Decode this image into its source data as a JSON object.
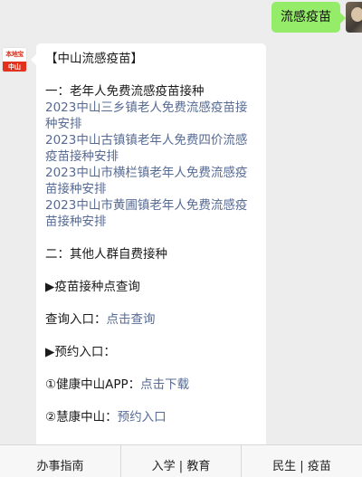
{
  "outgoing": {
    "text": "流感疫苗"
  },
  "bot_avatar": {
    "brand": "本地宝",
    "city": "中山"
  },
  "message": {
    "title": "【中山流感疫苗】",
    "section1": "一：老年人免费流感疫苗接种",
    "links": [
      "2023中山三乡镇老人免费流感疫苗接种安排",
      "2023中山古镇镇老年人免费四价流感疫苗接种安排",
      "2023中山市横栏镇老年人免费流感疫苗接种安排",
      "2023中山市黄圃镇老年人免费流感疫苗接种安排"
    ],
    "section2": "二：其他人群自费接种",
    "query_heading": "▶疫苗接种点查询",
    "query_label": "查询入口：",
    "query_link": "点击查询",
    "booking_heading": "▶预约入口：",
    "app1_label": "①健康中山APP：",
    "app1_link": "点击下载",
    "app2_label": "②慧康中山：",
    "app2_link": "预约入口"
  },
  "menu": {
    "items": [
      "办事指南",
      "入学 | 教育",
      "民生 | 疫苗"
    ]
  }
}
